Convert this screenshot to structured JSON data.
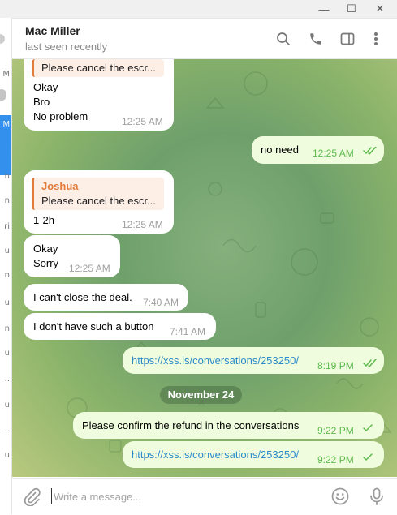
{
  "window": {
    "controls": {
      "minimize": "—",
      "maximize": "☐",
      "close": "✕"
    }
  },
  "left_strip_fragments": [
    "M",
    "M",
    "h",
    "n",
    "ri",
    "u",
    "n",
    "u",
    "n",
    "u",
    "..",
    "u",
    "..",
    "u"
  ],
  "header": {
    "name": "Mac Miller",
    "status": "last seen recently",
    "icons": [
      "search-icon",
      "phone-icon",
      "sidebar-toggle-icon",
      "more-vertical-icon"
    ]
  },
  "messages": {
    "m1_reply": "Please cancel the escr...",
    "m1_line1": "Okay",
    "m1_line2": "Bro",
    "m1_line3": "No problem",
    "m1_time": "12:25 AM",
    "m2_text": "no  need",
    "m2_time": "12:25 AM",
    "m3_reply_author": "Joshua",
    "m3_reply_text": "Please cancel the escr...",
    "m3_text": "1-2h",
    "m3_time": "12:25 AM",
    "m4_line1": "Okay",
    "m4_line2": "Sorry",
    "m4_time": "12:25 AM",
    "m5_text": "I can't close the deal.",
    "m5_time": "7:40 AM",
    "m6_text": "I don't have such a button",
    "m6_time": "7:41 AM",
    "m7_text": "https://xss.is/conversations/253250/",
    "m7_time": "8:19 PM",
    "date_separator": "November 24",
    "m8_text": "Please confirm the refund in the conversations",
    "m8_time": "9:22 PM",
    "m9_text": "https://xss.is/conversations/253250/",
    "m9_time": "9:22 PM"
  },
  "composer": {
    "placeholder": "Write a message...",
    "icons": [
      "attach-icon",
      "emoji-icon",
      "microphone-icon"
    ]
  },
  "colors": {
    "accent": "#3390ec",
    "incoming_bubble": "#ffffff",
    "outgoing_bubble": "#effdde",
    "outgoing_meta": "#5eb94d",
    "link": "#2c8ac9",
    "reply_accent": "#e17b3a"
  }
}
